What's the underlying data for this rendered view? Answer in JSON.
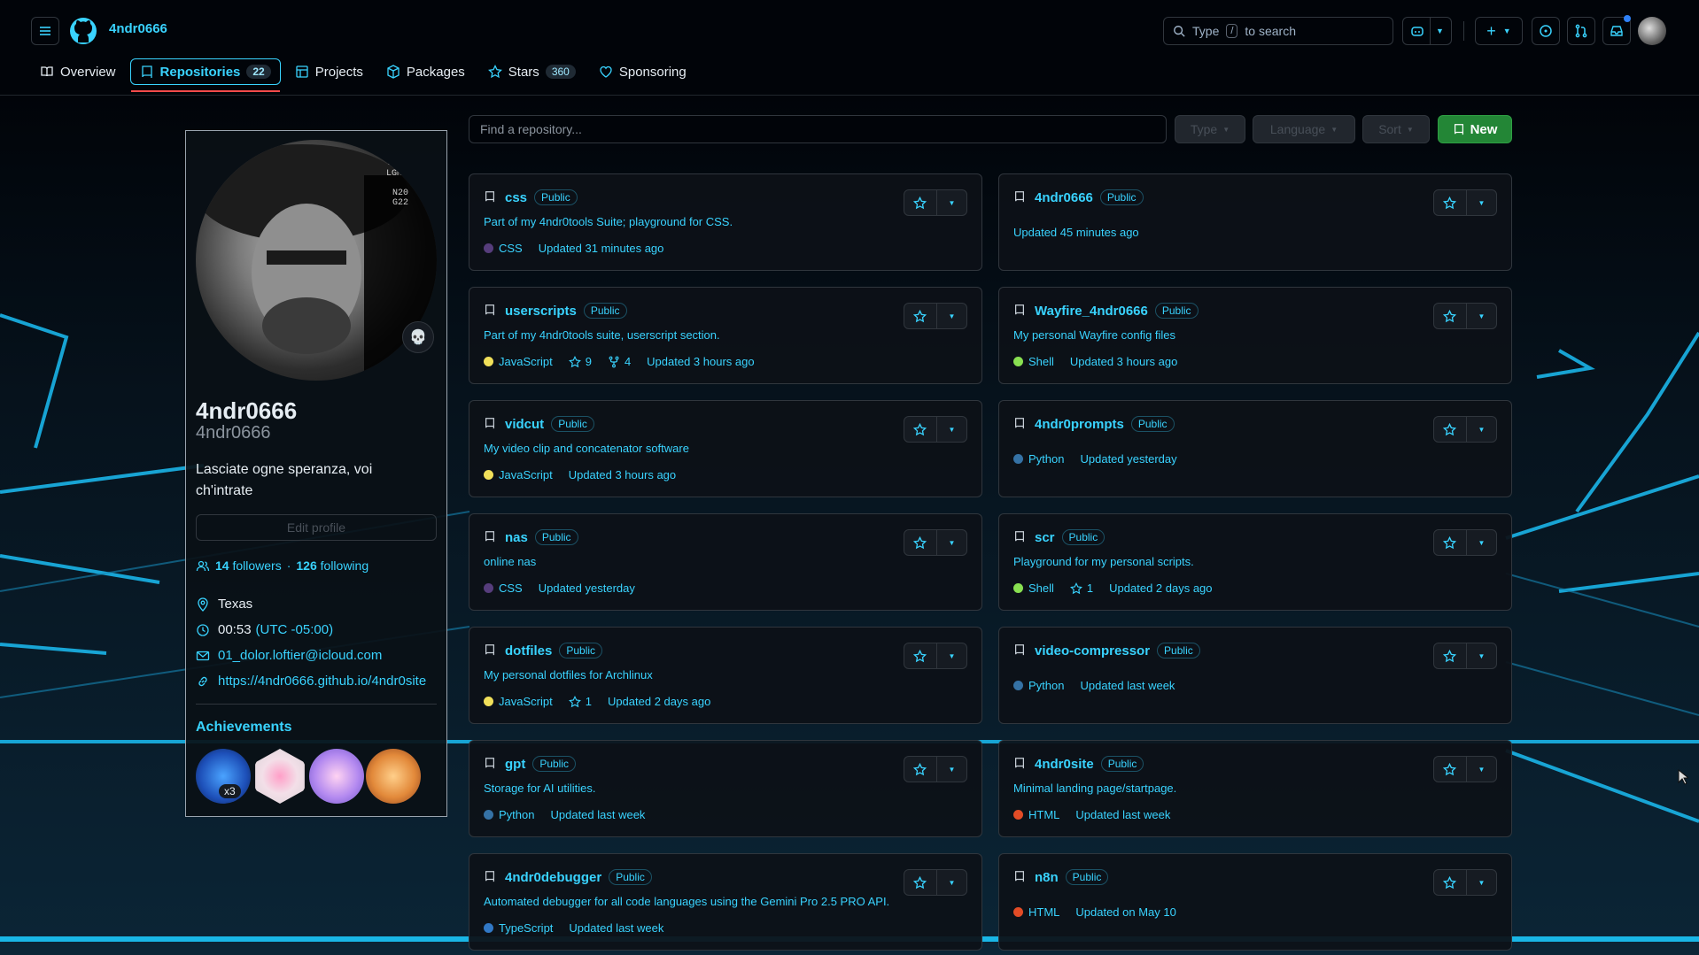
{
  "header": {
    "username": "4ndr0666",
    "search_placeholder_prefix": "Type",
    "search_key": "/",
    "search_placeholder_suffix": "to search"
  },
  "tabs": [
    {
      "label": "Overview",
      "icon": "book-icon"
    },
    {
      "label": "Repositories",
      "count": "22",
      "icon": "repo-icon",
      "active": true
    },
    {
      "label": "Projects",
      "icon": "table-icon"
    },
    {
      "label": "Packages",
      "icon": "package-icon"
    },
    {
      "label": "Stars",
      "count": "360",
      "icon": "star-icon"
    },
    {
      "label": "Sponsoring",
      "icon": "heart-icon"
    }
  ],
  "profile": {
    "name": "4ndr0666",
    "login": "4ndr0666",
    "bio": "Lasciate ogne speranza, voi ch'intrate",
    "edit_label": "Edit profile",
    "followers_count": "14",
    "followers_label": "followers",
    "following_count": "126",
    "following_label": "following",
    "location": "Texas",
    "local_time": "00:53",
    "timezone": "(UTC -05:00)",
    "email": "01_dolor.loftier@icloud.com",
    "website": "https://4ndr0666.github.io/4ndr0site",
    "achievements_title": "Achievements",
    "achievement_multiplier": "x3",
    "status_emoji": "💀"
  },
  "filters": {
    "find_placeholder": "Find a repository...",
    "type_label": "Type",
    "language_label": "Language",
    "sort_label": "Sort",
    "new_label": "New"
  },
  "repos": [
    {
      "name": "css",
      "visibility": "Public",
      "description": "Part of my 4ndr0tools Suite; playground for CSS.",
      "language": "CSS",
      "lang_color": "#563d7c",
      "stars": "",
      "forks": "",
      "updated": "Updated 31 minutes ago"
    },
    {
      "name": "4ndr0666",
      "visibility": "Public",
      "description": "",
      "language": "",
      "lang_color": "",
      "stars": "",
      "forks": "",
      "updated": "Updated 45 minutes ago"
    },
    {
      "name": "userscripts",
      "visibility": "Public",
      "description": "Part of my 4ndr0tools suite, userscript section.",
      "language": "JavaScript",
      "lang_color": "#f1e05a",
      "stars": "9",
      "forks": "4",
      "updated": "Updated 3 hours ago"
    },
    {
      "name": "Wayfire_4ndr0666",
      "visibility": "Public",
      "description": "My personal Wayfire config files",
      "language": "Shell",
      "lang_color": "#89e051",
      "stars": "",
      "forks": "",
      "updated": "Updated 3 hours ago"
    },
    {
      "name": "vidcut",
      "visibility": "Public",
      "description": "My video clip and concatenator software",
      "language": "JavaScript",
      "lang_color": "#f1e05a",
      "stars": "",
      "forks": "",
      "updated": "Updated 3 hours ago"
    },
    {
      "name": "4ndr0prompts",
      "visibility": "Public",
      "description": "",
      "language": "Python",
      "lang_color": "#3572A5",
      "stars": "",
      "forks": "",
      "updated": "Updated yesterday"
    },
    {
      "name": "nas",
      "visibility": "Public",
      "description": "online nas",
      "language": "CSS",
      "lang_color": "#563d7c",
      "stars": "",
      "forks": "",
      "updated": "Updated yesterday"
    },
    {
      "name": "scr",
      "visibility": "Public",
      "description": "Playground for my personal scripts.",
      "language": "Shell",
      "lang_color": "#89e051",
      "stars": "1",
      "forks": "",
      "updated": "Updated 2 days ago"
    },
    {
      "name": "dotfiles",
      "visibility": "Public",
      "description": "My personal dotfiles for Archlinux",
      "language": "JavaScript",
      "lang_color": "#f1e05a",
      "stars": "1",
      "forks": "",
      "updated": "Updated 2 days ago"
    },
    {
      "name": "video-compressor",
      "visibility": "Public",
      "description": "",
      "language": "Python",
      "lang_color": "#3572A5",
      "stars": "",
      "forks": "",
      "updated": "Updated last week"
    },
    {
      "name": "gpt",
      "visibility": "Public",
      "description": "Storage for AI utilities.",
      "language": "Python",
      "lang_color": "#3572A5",
      "stars": "",
      "forks": "",
      "updated": "Updated last week"
    },
    {
      "name": "4ndr0site",
      "visibility": "Public",
      "description": "Minimal landing page/startpage.",
      "language": "HTML",
      "lang_color": "#e34c26",
      "stars": "",
      "forks": "",
      "updated": "Updated last week"
    },
    {
      "name": "4ndr0debugger",
      "visibility": "Public",
      "description": "Automated debugger for all code languages using the Gemini Pro 2.5 PRO API.",
      "language": "TypeScript",
      "lang_color": "#3178c6",
      "stars": "",
      "forks": "",
      "updated": "Updated last week"
    },
    {
      "name": "n8n",
      "visibility": "Public",
      "description": "",
      "language": "HTML",
      "lang_color": "#e34c26",
      "stars": "",
      "forks": "",
      "updated": "Updated on May 10"
    }
  ]
}
